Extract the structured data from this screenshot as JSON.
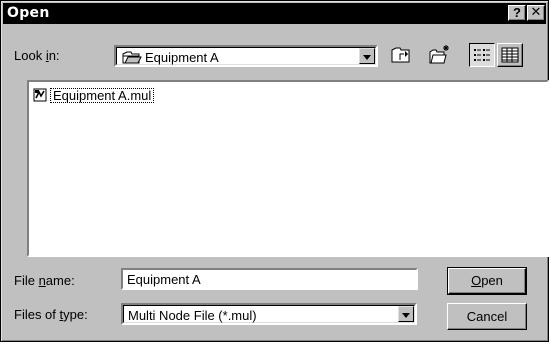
{
  "window": {
    "title": "Open",
    "help_label": "?",
    "close_label": "✕"
  },
  "look_in": {
    "label_pre": "Look ",
    "label_key": "i",
    "label_post": "n:",
    "value": "Equipment A"
  },
  "toolbar": {
    "up_one_level_icon": "up-folder-icon",
    "new_folder_icon": "new-folder-icon",
    "list_view_icon": "list-view-icon",
    "details_view_icon": "details-view-icon"
  },
  "files": [
    {
      "name": "Equipment A.mul",
      "icon": "mul-file-icon"
    }
  ],
  "file_name": {
    "label_pre": "File ",
    "label_key": "n",
    "label_post": "ame:",
    "value": "Equipment A"
  },
  "file_type": {
    "label_pre": "Files of ",
    "label_key": "t",
    "label_post": "ype:",
    "value": "Multi Node File (*.mul)"
  },
  "buttons": {
    "open_key": "O",
    "open_rest": "pen",
    "cancel": "Cancel"
  },
  "colors": {
    "title_bar": "#000000",
    "face": "#c0c0c0",
    "window": "#ffffff"
  }
}
